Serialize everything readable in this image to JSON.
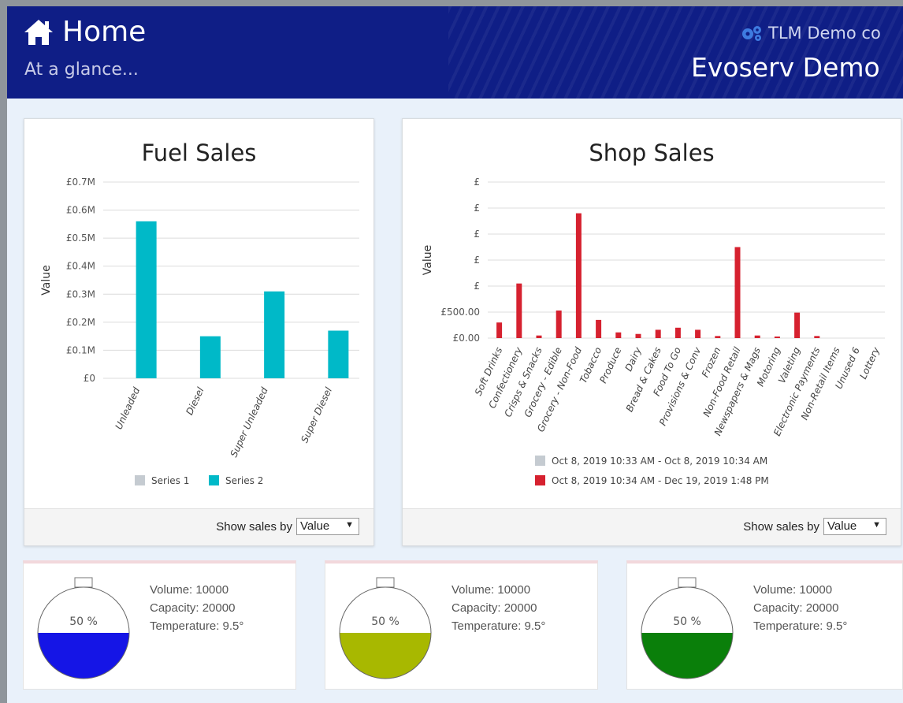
{
  "header": {
    "title": "Home",
    "subtitle": "At a glance...",
    "company": "TLM Demo co",
    "site": "Evoserv Demo"
  },
  "fuel_card": {
    "title": "Fuel Sales",
    "footer_label": "Show sales by",
    "select_value": "Value"
  },
  "shop_card": {
    "title": "Shop Sales",
    "footer_label": "Show sales by",
    "select_value": "Value"
  },
  "tanks": [
    {
      "level": "50 %",
      "fill": 0.5,
      "color": "#1515e6",
      "volume": "Volume: 10000",
      "capacity": "Capacity: 20000",
      "temperature": "Temperature: 9.5°"
    },
    {
      "level": "50 %",
      "fill": 0.5,
      "color": "#a8b800",
      "volume": "Volume: 10000",
      "capacity": "Capacity: 20000",
      "temperature": "Temperature: 9.5°"
    },
    {
      "level": "50 %",
      "fill": 0.5,
      "color": "#0a7f0a",
      "volume": "Volume: 10000",
      "capacity": "Capacity: 20000",
      "temperature": "Temperature: 9.5°"
    }
  ],
  "chart_data": [
    {
      "type": "bar",
      "title": "Fuel Sales",
      "ylabel": "Value",
      "xlabel": "",
      "categories": [
        "Unleaded",
        "Diesel",
        "Super Unleaded",
        "Super Diesel"
      ],
      "series": [
        {
          "name": "Series 1",
          "color": "#c5cbd1",
          "values": [
            0,
            0,
            0,
            0
          ]
        },
        {
          "name": "Series 2",
          "color": "#00b9c8",
          "values": [
            0.56,
            0.15,
            0.31,
            0.17
          ]
        }
      ],
      "yticks": [
        "£0",
        "£0.1M",
        "£0.2M",
        "£0.3M",
        "£0.4M",
        "£0.5M",
        "£0.6M",
        "£0.7M"
      ],
      "ylim": [
        0,
        0.7
      ],
      "grid": true,
      "legend": "bottom"
    },
    {
      "type": "bar",
      "title": "Shop Sales",
      "ylabel": "Value",
      "xlabel": "",
      "categories": [
        "Soft Drinks",
        "Confectionery",
        "Crisps & Snacks",
        "Grocery - Edible",
        "Grocery - Non-Food",
        "Tobacco",
        "Produce",
        "Dairy",
        "Bread & Cakes",
        "Food To Go",
        "Provisions & Conv",
        "Frozen",
        "Non-Food Retail",
        "Newspapers & Mags",
        "Motoring",
        "Valeting",
        "Electronic Payments",
        "Non-Retail Items",
        "Unused 6",
        "Lottery"
      ],
      "series": [
        {
          "name": "Oct 8, 2019 10:33 AM - Oct 8, 2019 10:34 AM",
          "color": "#c5cbd1",
          "values": [
            0,
            0,
            0,
            0,
            0,
            0,
            0,
            0,
            0,
            0,
            0,
            0,
            0,
            0,
            0,
            0,
            0,
            0,
            0,
            0
          ]
        },
        {
          "name": "Oct 8, 2019 10:34 AM - Dec 19, 2019 1:48 PM",
          "color": "#d6212f",
          "values": [
            300,
            1050,
            50,
            530,
            2400,
            350,
            110,
            80,
            160,
            200,
            160,
            40,
            1750,
            50,
            30,
            490,
            40,
            0,
            0,
            0
          ]
        }
      ],
      "yticks": [
        "£0.00",
        "£500.00",
        "£",
        "£",
        "£",
        "£",
        "£"
      ],
      "ylim": [
        0,
        3000
      ],
      "grid": true,
      "legend": "bottom"
    }
  ]
}
